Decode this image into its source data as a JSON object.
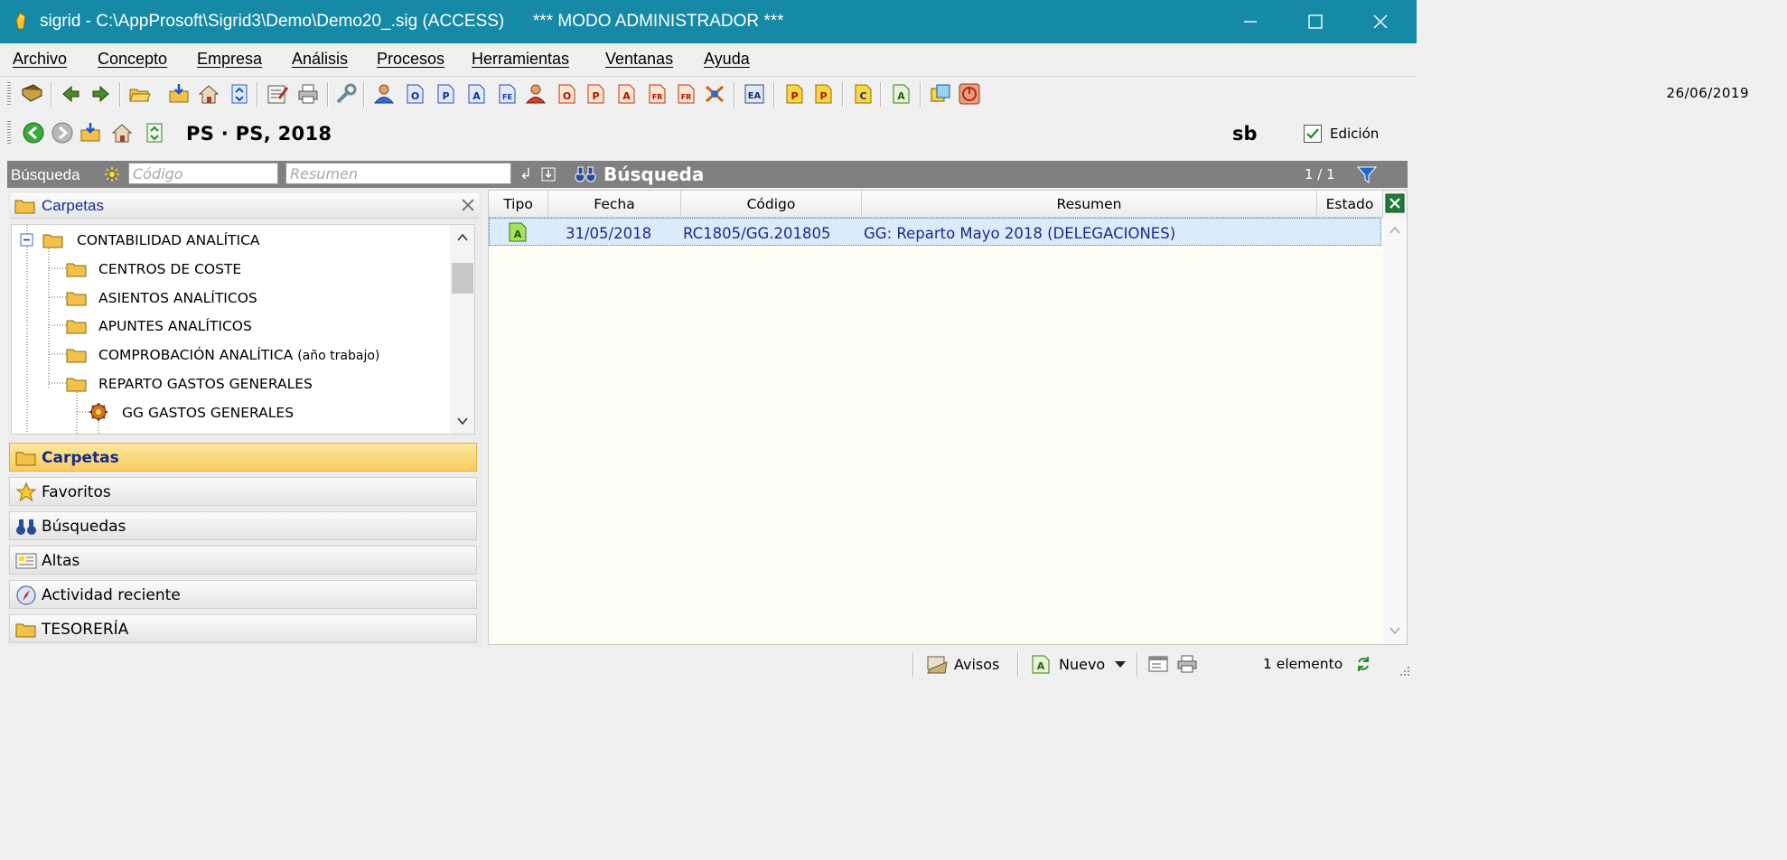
{
  "window": {
    "title": "sigrid - C:\\AppProsoft\\Sigrid3\\Demo\\Demo20_.sig (ACCESS)      *** MODO ADMINISTRADOR ***",
    "minimize_icon": "minimize-icon",
    "maximize_icon": "maximize-icon",
    "close_icon": "close-icon"
  },
  "menu": [
    "Archivo",
    "Concepto",
    "Empresa",
    "Análisis",
    "Procesos",
    "Herramientas",
    "Ventanas",
    "Ayuda"
  ],
  "toolbar": {
    "date": "26/06/2019"
  },
  "toolbar2": {
    "title": "PS · PS, 2018",
    "user": "sb",
    "edit_label": "Edición",
    "edit_checked": true
  },
  "search": {
    "label": "Búsqueda",
    "code_placeholder": "Código",
    "summary_placeholder": "Resumen",
    "title": "Búsqueda",
    "page": "1 / 1"
  },
  "folders_header": "Carpetas",
  "tree": [
    "CONTABILIDAD ANALÍTICA",
    "CENTROS DE COSTE",
    "ASIENTOS ANALÍTICOS",
    "APUNTES ANALÍTICOS",
    "COMPROBACIÓN ANALÍTICA",
    "(año trabajo)",
    "REPARTO GASTOS GENERALES",
    "GG  GASTOS GENERALES"
  ],
  "nav": {
    "carpetas": "Carpetas",
    "favoritos": "Favoritos",
    "busquedas": "Búsquedas",
    "altas": "Altas",
    "actividad": "Actividad reciente",
    "tesoreria": "TESORERÍA"
  },
  "grid": {
    "columns": [
      "Tipo",
      "Fecha",
      "Código",
      "Resumen",
      "Estado"
    ],
    "rows": [
      {
        "tipo": "A",
        "fecha": "31/05/2018",
        "codigo": "RC1805/GG.201805",
        "resumen": "GG: Reparto Mayo 2018 (DELEGACIONES)",
        "estado": ""
      }
    ]
  },
  "status": {
    "avisos": "Avisos",
    "nuevo": "Nuevo",
    "count": "1 elemento"
  },
  "colors": {
    "titlebar": "#1589a6",
    "accent_text": "#1a2a8a",
    "selected_nav": "#fbd871",
    "grid_bg": "#fffff5"
  }
}
